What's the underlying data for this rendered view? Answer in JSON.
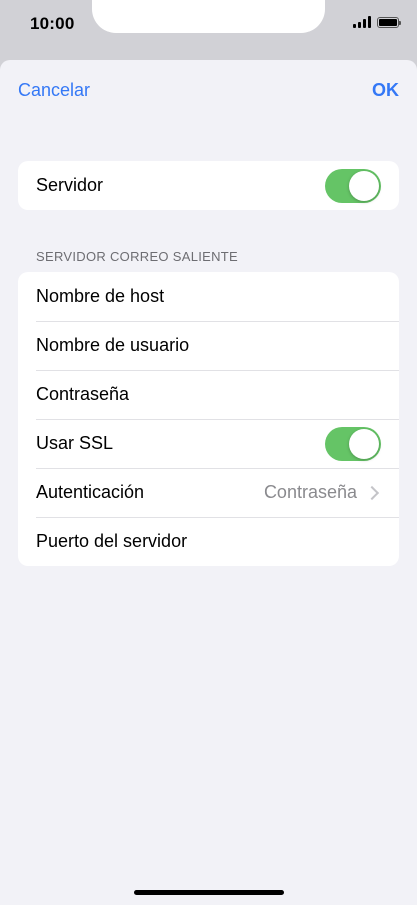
{
  "status_bar": {
    "time": "10:00"
  },
  "nav": {
    "cancel_label": "Cancelar",
    "ok_label": "OK"
  },
  "server_group": {
    "label": "Servidor",
    "enabled": true
  },
  "outgoing": {
    "header": "SERVIDOR CORREO SALIENTE",
    "host_label": "Nombre de host",
    "username_label": "Nombre de usuario",
    "password_label": "Contraseña",
    "ssl_label": "Usar SSL",
    "ssl_enabled": true,
    "auth_label": "Autenticación",
    "auth_value": "Contraseña",
    "port_label": "Puerto del servidor"
  },
  "colors": {
    "accent": "#3478f6",
    "toggle_on": "#65c466",
    "background": "#f2f2f7"
  }
}
